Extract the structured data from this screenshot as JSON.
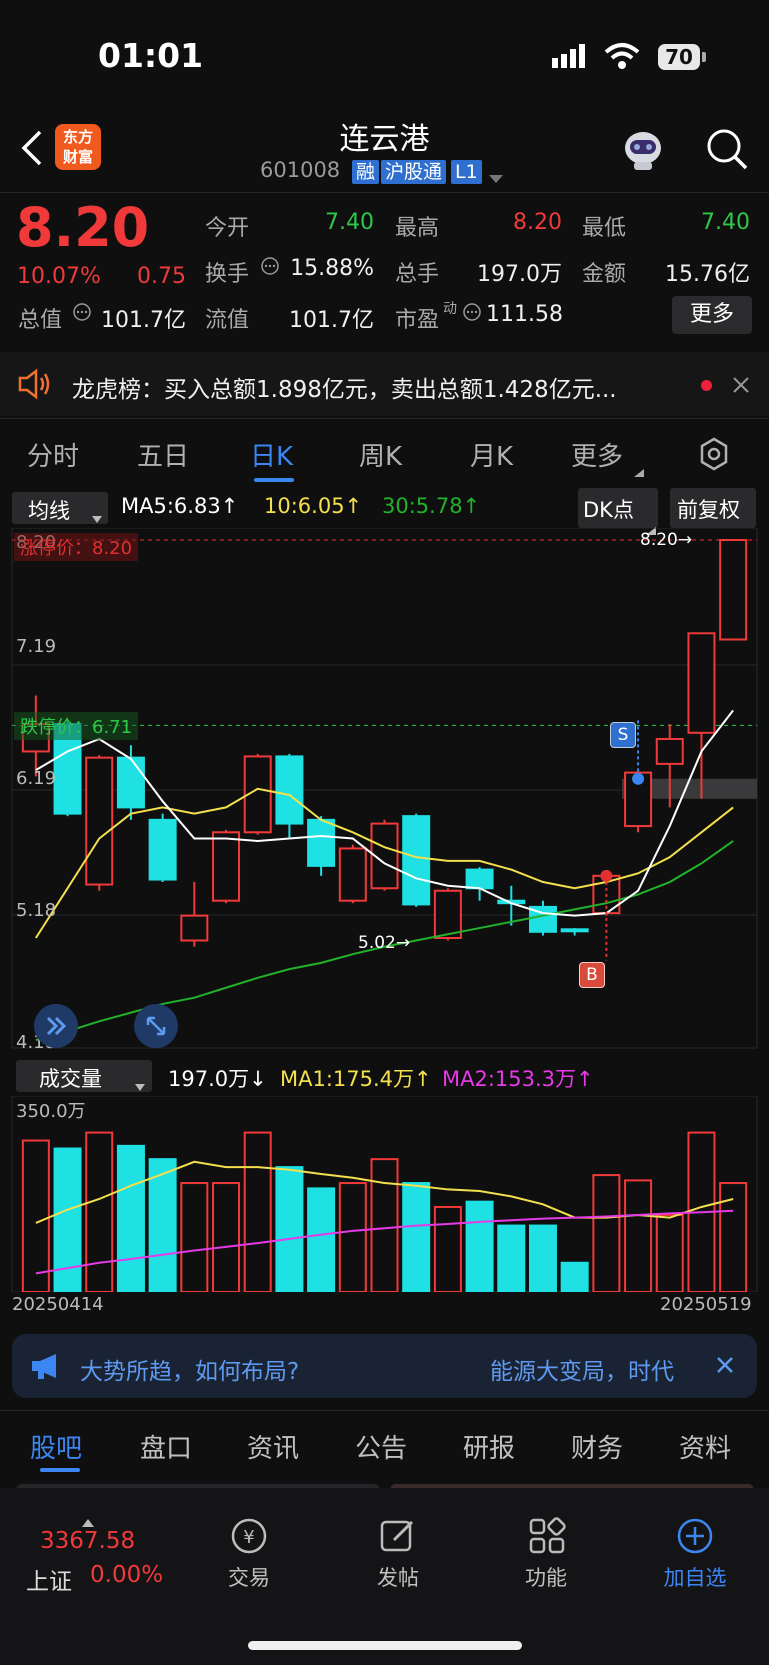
{
  "status": {
    "time": "01:01",
    "battery": "70"
  },
  "header": {
    "title": "连云港",
    "code": "601008",
    "tags": [
      "融",
      "沪股通",
      "L1"
    ],
    "logo_line1": "东方",
    "logo_line2": "财富"
  },
  "quote": {
    "price": "8.20",
    "pct": "10.07%",
    "chg": "0.75",
    "open_label": "今开",
    "open": "7.40",
    "high_label": "最高",
    "high": "8.20",
    "low_label": "最低",
    "low": "7.40",
    "turnover_label": "换手",
    "turnover": "15.88%",
    "vol_label": "总手",
    "vol": "197.0万",
    "amount_label": "金额",
    "amount": "15.76亿",
    "mcap_label": "总值",
    "mcap": "101.7亿",
    "float_label": "流值",
    "float": "101.7亿",
    "pe_label": "市盈",
    "pe_sup": "动",
    "pe": "111.58",
    "more": "更多"
  },
  "notice": {
    "text": "龙虎榜：买入总额1.898亿元，卖出总额1.428亿元..."
  },
  "tabs": [
    "分时",
    "五日",
    "日K",
    "周K",
    "月K",
    "更多"
  ],
  "ma_legend": {
    "selector": "均线",
    "ma5": "MA5:6.83↑",
    "ma10": "10:6.05↑",
    "ma30": "30:5.78↑",
    "dk": "DK点",
    "fq": "前复权"
  },
  "price_chart": {
    "limit_up_label": "涨停价：8.20",
    "limit_down_label": "跌停价：6.71",
    "y_labels": [
      "8.20",
      "7.19",
      "6.19",
      "5.18",
      "4.18"
    ],
    "max_label": "8.20→",
    "min_label": "5.02→",
    "sell_marker": "S",
    "buy_marker": "B"
  },
  "vol_legend": {
    "selector": "成交量",
    "vol": "197.0万↓",
    "ma1": "MA1:175.4万↑",
    "ma2": "MA2:153.3万↑",
    "max": "350.0万",
    "date_start": "20250414",
    "date_end": "20250519"
  },
  "chart_data": {
    "type": "candlestick",
    "ylim": [
      4.18,
      8.2
    ],
    "candles": [
      {
        "o": 6.5,
        "c": 6.72,
        "h": 6.95,
        "l": 6.3
      },
      {
        "o": 6.72,
        "c": 6.0,
        "h": 6.75,
        "l": 5.98
      },
      {
        "o": 5.43,
        "c": 6.45,
        "h": 6.47,
        "l": 5.38
      },
      {
        "o": 6.45,
        "c": 6.05,
        "h": 6.55,
        "l": 5.95
      },
      {
        "o": 5.95,
        "c": 5.47,
        "h": 6.0,
        "l": 5.45
      },
      {
        "o": 4.98,
        "c": 5.18,
        "h": 5.45,
        "l": 4.93
      },
      {
        "o": 5.3,
        "c": 5.85,
        "h": 5.87,
        "l": 5.28
      },
      {
        "o": 5.85,
        "c": 6.46,
        "h": 6.48,
        "l": 5.83
      },
      {
        "o": 6.46,
        "c": 5.92,
        "h": 6.48,
        "l": 5.8
      },
      {
        "o": 5.95,
        "c": 5.58,
        "h": 5.98,
        "l": 5.5
      },
      {
        "o": 5.3,
        "c": 5.72,
        "h": 5.75,
        "l": 5.28
      },
      {
        "o": 5.4,
        "c": 5.92,
        "h": 5.95,
        "l": 5.38
      },
      {
        "o": 5.98,
        "c": 5.27,
        "h": 6.0,
        "l": 5.25
      },
      {
        "o": 5.0,
        "c": 5.38,
        "h": 5.4,
        "l": 4.98
      },
      {
        "o": 5.55,
        "c": 5.4,
        "h": 5.57,
        "l": 5.3
      },
      {
        "o": 5.3,
        "c": 5.28,
        "h": 5.42,
        "l": 5.1
      },
      {
        "o": 5.25,
        "c": 5.05,
        "h": 5.3,
        "l": 5.02
      },
      {
        "o": 5.07,
        "c": 5.06,
        "h": 5.08,
        "l": 5.02
      },
      {
        "o": 5.2,
        "c": 5.5,
        "h": 5.52,
        "l": 5.18
      },
      {
        "o": 5.9,
        "c": 6.33,
        "h": 6.35,
        "l": 5.85
      },
      {
        "o": 6.4,
        "c": 6.6,
        "h": 6.72,
        "l": 6.05
      },
      {
        "o": 6.65,
        "c": 7.45,
        "h": 7.45,
        "l": 6.12
      },
      {
        "o": 7.4,
        "c": 8.2,
        "h": 8.2,
        "l": 7.4
      }
    ],
    "ma5": [
      6.35,
      6.5,
      6.6,
      6.44,
      6.1,
      5.8,
      5.8,
      5.78,
      5.8,
      5.82,
      5.8,
      5.6,
      5.48,
      5.42,
      5.4,
      5.28,
      5.2,
      5.18,
      5.2,
      5.38,
      5.9,
      6.5,
      6.83
    ],
    "ma10": [
      5.0,
      5.4,
      5.8,
      6.0,
      6.05,
      6.0,
      6.05,
      6.2,
      6.15,
      5.95,
      5.85,
      5.73,
      5.65,
      5.62,
      5.62,
      5.55,
      5.45,
      5.4,
      5.45,
      5.52,
      5.65,
      5.85,
      6.05
    ],
    "ma30": [
      4.18,
      4.25,
      4.33,
      4.4,
      4.47,
      4.52,
      4.6,
      4.68,
      4.75,
      4.8,
      4.87,
      4.93,
      4.98,
      5.03,
      5.08,
      5.13,
      5.18,
      5.23,
      5.28,
      5.35,
      5.45,
      5.6,
      5.78
    ],
    "volumes": [
      285,
      270,
      300,
      275,
      250,
      205,
      205,
      300,
      235,
      195,
      205,
      250,
      205,
      160,
      170,
      125,
      125,
      55,
      220,
      210,
      145,
      300,
      205
    ],
    "vol_ma1": [
      130,
      155,
      175,
      200,
      222,
      245,
      235,
      235,
      230,
      222,
      215,
      205,
      200,
      193,
      190,
      180,
      165,
      140,
      140,
      145,
      140,
      160,
      175
    ],
    "vol_ma2": [
      35,
      45,
      55,
      62,
      70,
      78,
      85,
      92,
      100,
      108,
      115,
      120,
      125,
      128,
      132,
      135,
      138,
      140,
      142,
      145,
      148,
      150,
      153
    ],
    "vol_max": 350
  },
  "promo": {
    "left": "大势所趋，如何布局?",
    "right": "能源大变局，时代"
  },
  "bottom_tabs": [
    "股吧",
    "盘口",
    "资讯",
    "公告",
    "研报",
    "财务",
    "资料"
  ],
  "bottom_nav": {
    "index_value": "3367.58",
    "index_name": "上证",
    "index_pct": "0.00%",
    "trade": "交易",
    "post": "发帖",
    "func": "功能",
    "add": "加自选"
  },
  "colors": {
    "up": "#f03a3a",
    "down": "#1fe0e3",
    "ma5": "#ffffff",
    "ma10": "#f4e04d",
    "ma30": "#22b22a",
    "vma1": "#f4e04d",
    "vma2": "#e53ae5",
    "accent": "#2f6fcf"
  }
}
